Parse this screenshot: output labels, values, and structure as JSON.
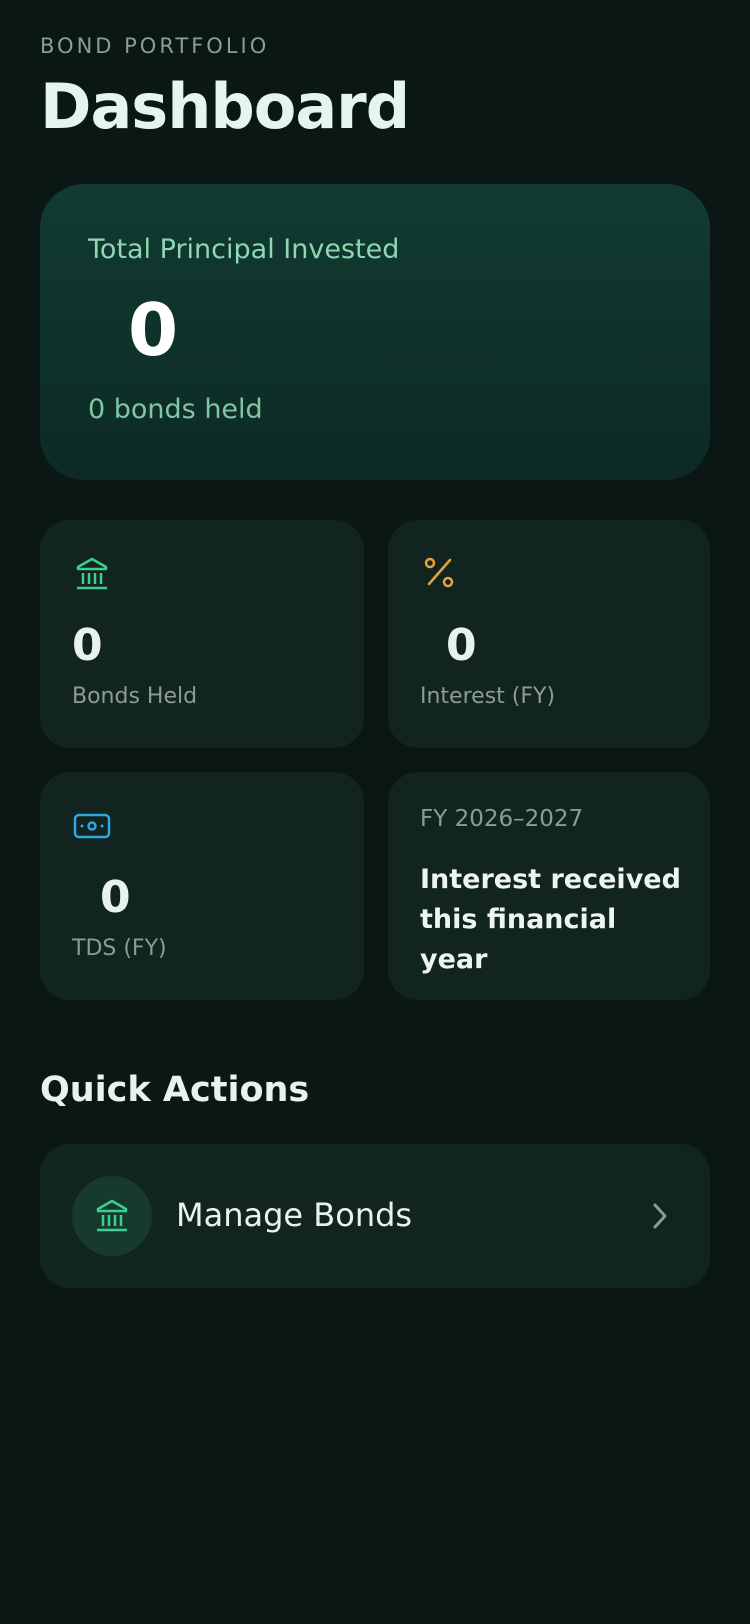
{
  "header": {
    "eyebrow": "BOND PORTFOLIO",
    "title": "Dashboard"
  },
  "hero": {
    "label": "Total Principal Invested",
    "value": "0",
    "sub": "0 bonds held"
  },
  "stats": {
    "bonds_held": {
      "icon": "bank-icon",
      "value": "0",
      "label": "Bonds Held",
      "color": "#3ccf8e"
    },
    "interest": {
      "icon": "percent-icon",
      "value": "0",
      "label": "Interest (FY)",
      "color": "#e8a33a"
    },
    "tds": {
      "icon": "cash-icon",
      "value": "0",
      "label": "TDS (FY)",
      "color": "#2ea6e0"
    },
    "fy": {
      "label": "FY 2026–2027",
      "description": "Interest received this financial year"
    }
  },
  "quick_actions": {
    "title": "Quick Actions",
    "items": [
      {
        "icon": "bank-icon",
        "label": "Manage Bonds"
      }
    ]
  },
  "colors": {
    "background": "#0a1714",
    "card": "#12241f",
    "accent": "#3ccf8e"
  }
}
